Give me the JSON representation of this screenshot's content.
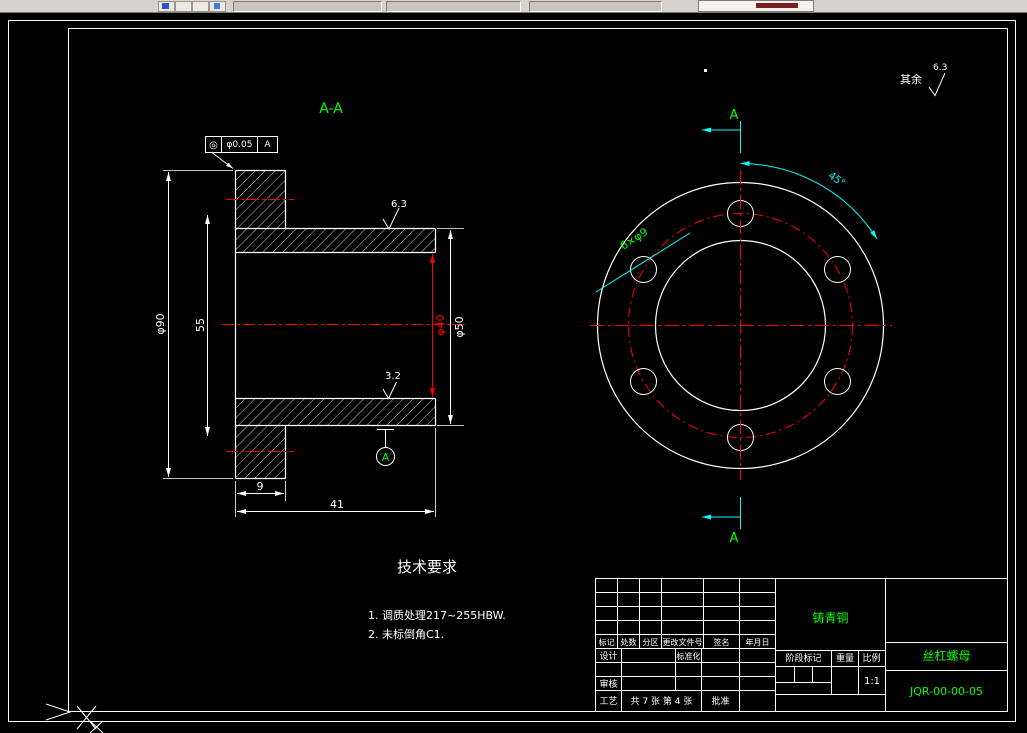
{
  "annotations": {
    "section_view_title": "A-A",
    "surface_general_prefix": "其余",
    "surface_general_value": "6.3",
    "surface_top": "6.3",
    "surface_bore": "3.2",
    "datum_letter": "A",
    "section_letter_top": "A",
    "section_letter_bottom": "A",
    "tolerance_symbol": "◎",
    "tolerance_value": "φ0.05",
    "tolerance_datum": "A",
    "hole_callout": "6×φ9",
    "angle_dimension": "45°"
  },
  "dimensions": {
    "flange_diameter": "φ90",
    "length_55": "55",
    "outer_diameter": "φ50",
    "bore_diameter": "φ40",
    "flange_thickness": "9",
    "overall_length": "41"
  },
  "tech_requirements": {
    "title": "技术要求",
    "item1": "1. 调质处理217~255HBW.",
    "item2": "2. 未标倒角C1."
  },
  "title_block": {
    "material": "铸青铜",
    "part_name": "丝杠螺母",
    "drawing_number": "JQR-00-00-05",
    "scale_value": "1:1",
    "sheet_info": "共 7 张 第 4 张",
    "labels": {
      "mark": "标记",
      "count": "处数",
      "zone": "分区",
      "change_doc": "更改文件号",
      "signature": "签名",
      "date": "年月日",
      "design": "设计",
      "standardization": "标准化",
      "check": "审核",
      "process": "工艺",
      "approve": "批准",
      "stage_mark": "阶段标记",
      "weight": "重量",
      "scale": "比例"
    }
  }
}
